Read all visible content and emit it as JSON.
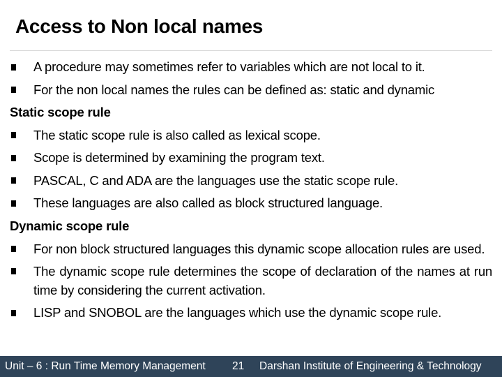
{
  "slide": {
    "title": "Access to Non local names",
    "blocks": [
      {
        "type": "bullet",
        "text": "A procedure may sometimes refer to variables which are not local to it."
      },
      {
        "type": "bullet",
        "text": "For the non local names the rules can be defined as: static and dynamic"
      },
      {
        "type": "heading",
        "text": "Static scope rule"
      },
      {
        "type": "bullet",
        "text": "The static scope rule is also called as lexical scope."
      },
      {
        "type": "bullet",
        "text": "Scope is determined by examining the program text."
      },
      {
        "type": "bullet",
        "text": "PASCAL, C and ADA are the languages use the static scope rule."
      },
      {
        "type": "bullet",
        "text": "These languages are also called as block structured language."
      },
      {
        "type": "heading",
        "text": "Dynamic scope rule"
      },
      {
        "type": "bullet",
        "text": "For non block structured languages this dynamic scope allocation rules are used."
      },
      {
        "type": "bullet",
        "text": "The dynamic scope rule determines the scope of declaration of the names at run time by considering the current activation."
      },
      {
        "type": "bullet",
        "text": "LISP and SNOBOL are the languages which use the dynamic scope rule."
      }
    ],
    "bullet_icon": "black-square"
  },
  "footer": {
    "unit": "Unit – 6 : Run Time Memory Management",
    "page_number": "21",
    "institute": "Darshan Institute of Engineering & Technology",
    "background_color": "#2f4459"
  }
}
